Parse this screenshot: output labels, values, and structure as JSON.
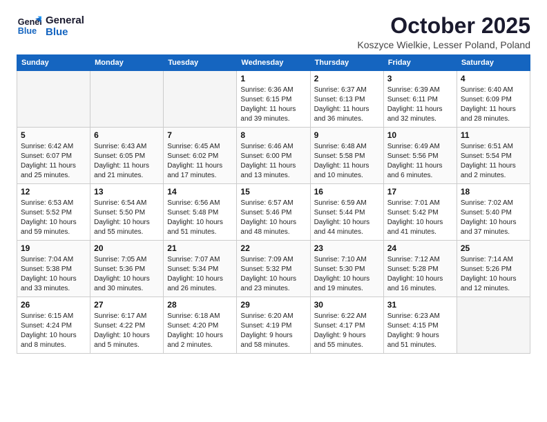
{
  "logo": {
    "line1": "General",
    "line2": "Blue"
  },
  "title": "October 2025",
  "location": "Koszyce Wielkie, Lesser Poland, Poland",
  "weekdays": [
    "Sunday",
    "Monday",
    "Tuesday",
    "Wednesday",
    "Thursday",
    "Friday",
    "Saturday"
  ],
  "weeks": [
    [
      {
        "day": "",
        "info": ""
      },
      {
        "day": "",
        "info": ""
      },
      {
        "day": "",
        "info": ""
      },
      {
        "day": "1",
        "info": "Sunrise: 6:36 AM\nSunset: 6:15 PM\nDaylight: 11 hours\nand 39 minutes."
      },
      {
        "day": "2",
        "info": "Sunrise: 6:37 AM\nSunset: 6:13 PM\nDaylight: 11 hours\nand 36 minutes."
      },
      {
        "day": "3",
        "info": "Sunrise: 6:39 AM\nSunset: 6:11 PM\nDaylight: 11 hours\nand 32 minutes."
      },
      {
        "day": "4",
        "info": "Sunrise: 6:40 AM\nSunset: 6:09 PM\nDaylight: 11 hours\nand 28 minutes."
      }
    ],
    [
      {
        "day": "5",
        "info": "Sunrise: 6:42 AM\nSunset: 6:07 PM\nDaylight: 11 hours\nand 25 minutes."
      },
      {
        "day": "6",
        "info": "Sunrise: 6:43 AM\nSunset: 6:05 PM\nDaylight: 11 hours\nand 21 minutes."
      },
      {
        "day": "7",
        "info": "Sunrise: 6:45 AM\nSunset: 6:02 PM\nDaylight: 11 hours\nand 17 minutes."
      },
      {
        "day": "8",
        "info": "Sunrise: 6:46 AM\nSunset: 6:00 PM\nDaylight: 11 hours\nand 13 minutes."
      },
      {
        "day": "9",
        "info": "Sunrise: 6:48 AM\nSunset: 5:58 PM\nDaylight: 11 hours\nand 10 minutes."
      },
      {
        "day": "10",
        "info": "Sunrise: 6:49 AM\nSunset: 5:56 PM\nDaylight: 11 hours\nand 6 minutes."
      },
      {
        "day": "11",
        "info": "Sunrise: 6:51 AM\nSunset: 5:54 PM\nDaylight: 11 hours\nand 2 minutes."
      }
    ],
    [
      {
        "day": "12",
        "info": "Sunrise: 6:53 AM\nSunset: 5:52 PM\nDaylight: 10 hours\nand 59 minutes."
      },
      {
        "day": "13",
        "info": "Sunrise: 6:54 AM\nSunset: 5:50 PM\nDaylight: 10 hours\nand 55 minutes."
      },
      {
        "day": "14",
        "info": "Sunrise: 6:56 AM\nSunset: 5:48 PM\nDaylight: 10 hours\nand 51 minutes."
      },
      {
        "day": "15",
        "info": "Sunrise: 6:57 AM\nSunset: 5:46 PM\nDaylight: 10 hours\nand 48 minutes."
      },
      {
        "day": "16",
        "info": "Sunrise: 6:59 AM\nSunset: 5:44 PM\nDaylight: 10 hours\nand 44 minutes."
      },
      {
        "day": "17",
        "info": "Sunrise: 7:01 AM\nSunset: 5:42 PM\nDaylight: 10 hours\nand 41 minutes."
      },
      {
        "day": "18",
        "info": "Sunrise: 7:02 AM\nSunset: 5:40 PM\nDaylight: 10 hours\nand 37 minutes."
      }
    ],
    [
      {
        "day": "19",
        "info": "Sunrise: 7:04 AM\nSunset: 5:38 PM\nDaylight: 10 hours\nand 33 minutes."
      },
      {
        "day": "20",
        "info": "Sunrise: 7:05 AM\nSunset: 5:36 PM\nDaylight: 10 hours\nand 30 minutes."
      },
      {
        "day": "21",
        "info": "Sunrise: 7:07 AM\nSunset: 5:34 PM\nDaylight: 10 hours\nand 26 minutes."
      },
      {
        "day": "22",
        "info": "Sunrise: 7:09 AM\nSunset: 5:32 PM\nDaylight: 10 hours\nand 23 minutes."
      },
      {
        "day": "23",
        "info": "Sunrise: 7:10 AM\nSunset: 5:30 PM\nDaylight: 10 hours\nand 19 minutes."
      },
      {
        "day": "24",
        "info": "Sunrise: 7:12 AM\nSunset: 5:28 PM\nDaylight: 10 hours\nand 16 minutes."
      },
      {
        "day": "25",
        "info": "Sunrise: 7:14 AM\nSunset: 5:26 PM\nDaylight: 10 hours\nand 12 minutes."
      }
    ],
    [
      {
        "day": "26",
        "info": "Sunrise: 6:15 AM\nSunset: 4:24 PM\nDaylight: 10 hours\nand 8 minutes."
      },
      {
        "day": "27",
        "info": "Sunrise: 6:17 AM\nSunset: 4:22 PM\nDaylight: 10 hours\nand 5 minutes."
      },
      {
        "day": "28",
        "info": "Sunrise: 6:18 AM\nSunset: 4:20 PM\nDaylight: 10 hours\nand 2 minutes."
      },
      {
        "day": "29",
        "info": "Sunrise: 6:20 AM\nSunset: 4:19 PM\nDaylight: 9 hours\nand 58 minutes."
      },
      {
        "day": "30",
        "info": "Sunrise: 6:22 AM\nSunset: 4:17 PM\nDaylight: 9 hours\nand 55 minutes."
      },
      {
        "day": "31",
        "info": "Sunrise: 6:23 AM\nSunset: 4:15 PM\nDaylight: 9 hours\nand 51 minutes."
      },
      {
        "day": "",
        "info": ""
      }
    ]
  ]
}
